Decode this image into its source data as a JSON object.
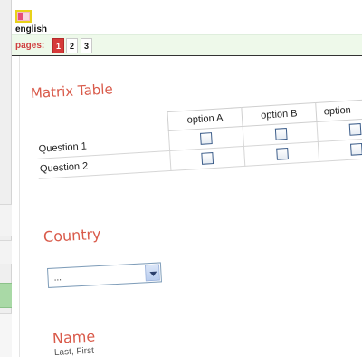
{
  "header": {
    "language_label": "english",
    "flag_icon": "uk-flag-icon"
  },
  "pagination": {
    "label": "pages:",
    "pages": [
      "1",
      "2",
      "3"
    ],
    "active_page": "1"
  },
  "matrix": {
    "title": "Matrix Table",
    "columns": [
      "option A",
      "option B",
      "option"
    ],
    "rows": [
      "Question 1",
      "Question 2"
    ]
  },
  "country": {
    "title": "Country",
    "selected_value": "..."
  },
  "name_field": {
    "title": "Name",
    "sublabel": "Last, First"
  },
  "colors": {
    "accent_title": "#d95a4a",
    "pagination_active": "#d63a3a",
    "pages_bar_bg": "#eef9ea"
  }
}
